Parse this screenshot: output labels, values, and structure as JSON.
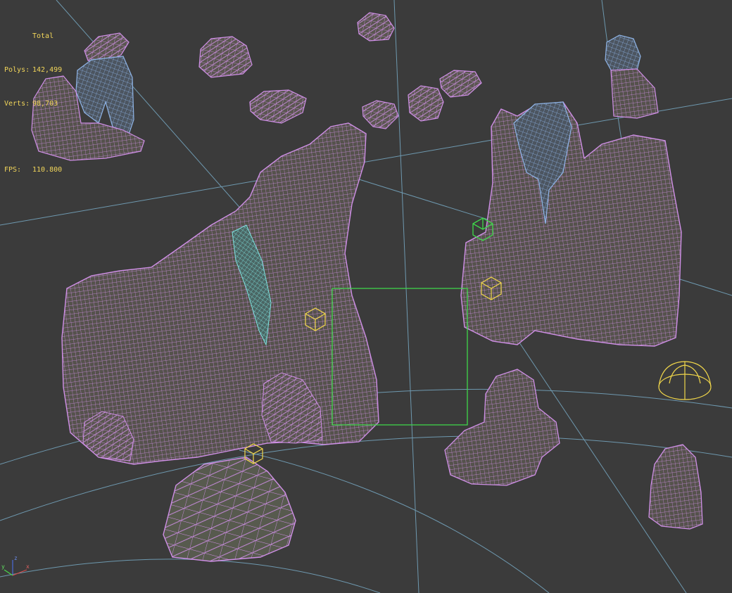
{
  "viewport": {
    "background": "#3b3b3b",
    "grid_color": "#7fb8d6",
    "wire_color": "#cf8fe6",
    "selected_wire_color": "#8fb4e6",
    "highlight_wire_color": "#7fe3e0",
    "selection_box_color": "#3fd84a",
    "helper_color": "#f0d64a"
  },
  "stats": {
    "title": "Total",
    "polys_label": "Polys:",
    "polys_value": "142,499",
    "verts_label": "Verts:",
    "verts_value": "98,703",
    "fps_label": "FPS:",
    "fps_value": "110.800"
  },
  "axis_gizmo": {
    "x_label": "x",
    "y_label": "y",
    "z_label": "z"
  }
}
